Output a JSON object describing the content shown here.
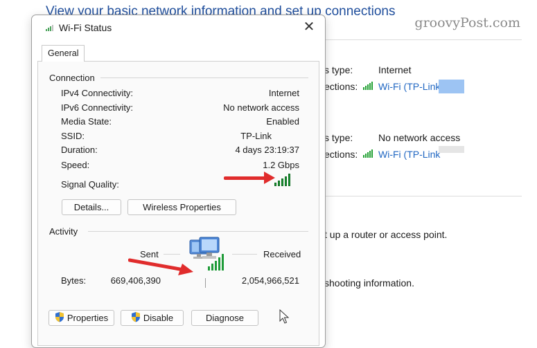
{
  "background": {
    "heading": "View your basic network information and set up connections",
    "watermark": "groovyPost.com",
    "network1": {
      "access_type_label": "s type:",
      "access_type_value": "Internet",
      "connections_label": "ections:",
      "connection_link": "Wi-Fi (TP-Link"
    },
    "network2": {
      "access_type_label": "s type:",
      "access_type_value": "No network access",
      "connections_label": "ections:",
      "connection_link": "Wi-Fi (TP-Link"
    },
    "setup_text": "t up a router or access point.",
    "troubleshoot_text": "shooting information."
  },
  "dialog": {
    "title": "Wi-Fi Status",
    "tabs": [
      "General"
    ],
    "connection": {
      "section_label": "Connection",
      "rows": [
        {
          "label": "IPv4 Connectivity:",
          "value": "Internet"
        },
        {
          "label": "IPv6 Connectivity:",
          "value": "No network access"
        },
        {
          "label": "Media State:",
          "value": "Enabled"
        },
        {
          "label": "SSID:",
          "value": "TP-Link"
        },
        {
          "label": "Duration:",
          "value": "4 days 23:19:37"
        },
        {
          "label": "Speed:",
          "value": "1.2 Gbps"
        }
      ],
      "signal_quality_label": "Signal Quality:",
      "details_button": "Details...",
      "wireless_properties_button": "Wireless Properties"
    },
    "activity": {
      "section_label": "Activity",
      "sent_label": "Sent",
      "received_label": "Received",
      "bytes_label": "Bytes:",
      "bytes_sent": "669,406,390",
      "bytes_received": "2,054,966,521"
    },
    "buttons": {
      "properties": "Properties",
      "disable": "Disable",
      "diagnose": "Diagnose"
    }
  },
  "colors": {
    "accent_link": "#1f66c2",
    "signal_green": "#1e9b38",
    "annotation_arrow": "#e02c2c"
  },
  "icons": [
    "wifi-signal-icon",
    "close-icon",
    "network-computers-icon",
    "shield-icon",
    "mouse-cursor-icon"
  ]
}
